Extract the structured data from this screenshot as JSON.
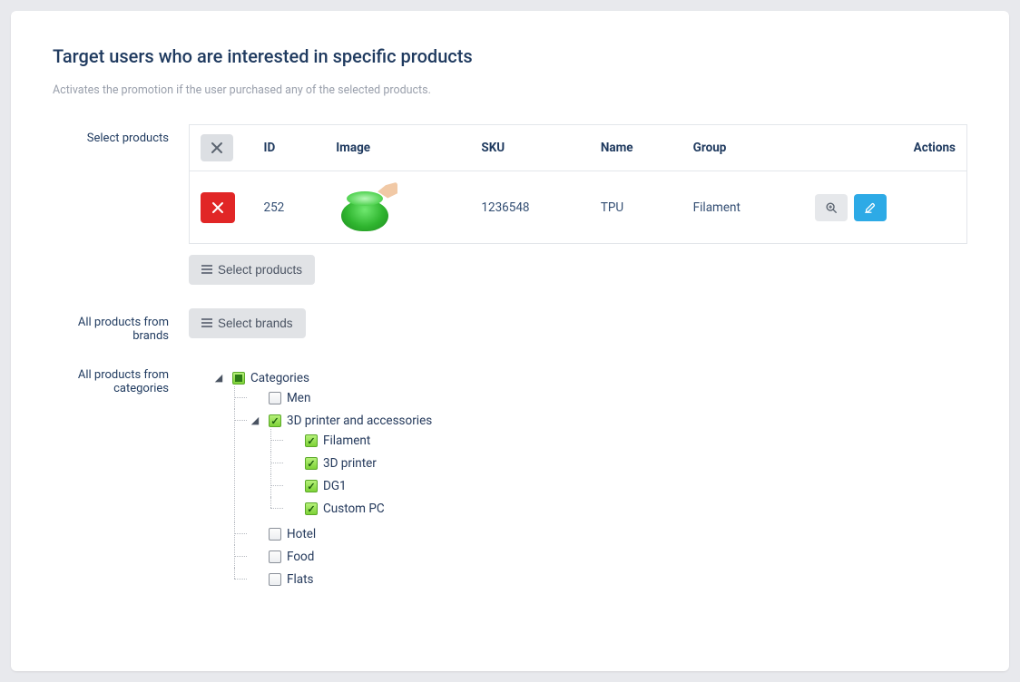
{
  "heading": "Target users who are interested in specific products",
  "subtitle": "Activates the promotion if the user purchased any of the selected products.",
  "labels": {
    "select_products": "Select products",
    "brands": "All products from brands",
    "categories": "All products from categories"
  },
  "table": {
    "columns": {
      "id": "ID",
      "image": "Image",
      "sku": "SKU",
      "name": "Name",
      "group": "Group",
      "actions": "Actions"
    },
    "rows": [
      {
        "id": "252",
        "sku": "1236548",
        "name": "TPU",
        "group": "Filament"
      }
    ]
  },
  "buttons": {
    "select_products": "Select products",
    "select_brands": "Select brands"
  },
  "tree": {
    "root": {
      "label": "Categories",
      "state": "partial",
      "expanded": true
    },
    "children": [
      {
        "label": "Men",
        "state": "none"
      },
      {
        "label": "3D printer and accessories",
        "state": "all",
        "expanded": true,
        "children": [
          {
            "label": "Filament",
            "state": "all"
          },
          {
            "label": "3D printer",
            "state": "all"
          },
          {
            "label": "DG1",
            "state": "all"
          },
          {
            "label": "Custom PC",
            "state": "all"
          }
        ]
      },
      {
        "label": "Hotel",
        "state": "none"
      },
      {
        "label": "Food",
        "state": "none"
      },
      {
        "label": "Flats",
        "state": "none"
      }
    ]
  }
}
